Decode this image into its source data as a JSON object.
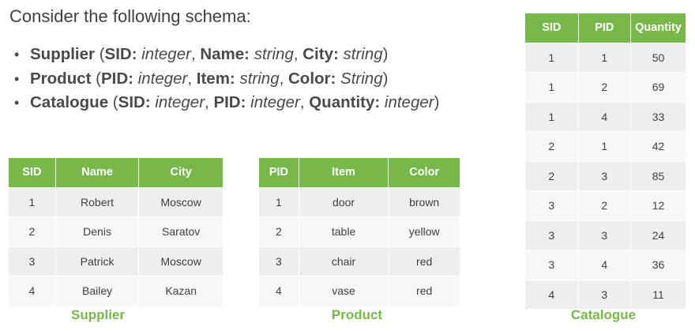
{
  "heading": "Consider the following schema:",
  "schema": [
    {
      "parts": [
        {
          "t": "Supplier",
          "s": "b"
        },
        {
          "t": " (",
          "s": ""
        },
        {
          "t": "SID:",
          "s": "b"
        },
        {
          "t": " integer",
          "s": "i"
        },
        {
          "t": ", ",
          "s": ""
        },
        {
          "t": "Name:",
          "s": "b"
        },
        {
          "t": " string",
          "s": "i"
        },
        {
          "t": ", ",
          "s": ""
        },
        {
          "t": "City:",
          "s": "b"
        },
        {
          "t": " string",
          "s": "i"
        },
        {
          "t": ")",
          "s": ""
        }
      ]
    },
    {
      "parts": [
        {
          "t": "Product",
          "s": "b"
        },
        {
          "t": " (",
          "s": ""
        },
        {
          "t": "PID:",
          "s": "b"
        },
        {
          "t": " integer",
          "s": "i"
        },
        {
          "t": ", ",
          "s": ""
        },
        {
          "t": "Item:",
          "s": "b"
        },
        {
          "t": " string",
          "s": "i"
        },
        {
          "t": ", ",
          "s": ""
        },
        {
          "t": "Color:",
          "s": "b"
        },
        {
          "t": " String",
          "s": "i"
        },
        {
          "t": ")",
          "s": ""
        }
      ]
    },
    {
      "parts": [
        {
          "t": "Catalogue",
          "s": "b"
        },
        {
          "t": " (",
          "s": ""
        },
        {
          "t": "SID:",
          "s": "b"
        },
        {
          "t": " integer",
          "s": "i"
        },
        {
          "t": ", ",
          "s": ""
        },
        {
          "t": "PID:",
          "s": "b"
        },
        {
          "t": " integer",
          "s": "i"
        },
        {
          "t": ", ",
          "s": ""
        },
        {
          "t": "Quantity:",
          "s": "b"
        },
        {
          "t": " integer",
          "s": "i"
        },
        {
          "t": ")",
          "s": ""
        }
      ]
    }
  ],
  "bullet": "•",
  "tables": {
    "supplier": {
      "caption": "Supplier",
      "headers": [
        "SID",
        "Name",
        "City"
      ],
      "rows": [
        [
          "1",
          "Robert",
          "Moscow"
        ],
        [
          "2",
          "Denis",
          "Saratov"
        ],
        [
          "3",
          "Patrick",
          "Moscow"
        ],
        [
          "4",
          "Bailey",
          "Kazan"
        ]
      ]
    },
    "product": {
      "caption": "Product",
      "headers": [
        "PID",
        "Item",
        "Color"
      ],
      "rows": [
        [
          "1",
          "door",
          "brown"
        ],
        [
          "2",
          "table",
          "yellow"
        ],
        [
          "3",
          "chair",
          "red"
        ],
        [
          "4",
          "vase",
          "red"
        ]
      ]
    },
    "catalogue": {
      "caption": "Catalogue",
      "headers": [
        "SID",
        "PID",
        "Quantity"
      ],
      "rows": [
        [
          "1",
          "1",
          "50"
        ],
        [
          "1",
          "2",
          "69"
        ],
        [
          "1",
          "4",
          "33"
        ],
        [
          "2",
          "1",
          "42"
        ],
        [
          "2",
          "3",
          "85"
        ],
        [
          "3",
          "2",
          "12"
        ],
        [
          "3",
          "3",
          "24"
        ],
        [
          "3",
          "4",
          "36"
        ],
        [
          "4",
          "3",
          "11"
        ]
      ]
    }
  },
  "colors": {
    "accent": "#78b84a",
    "row_even": "#eeeeee",
    "row_odd": "#f7f7f7"
  }
}
